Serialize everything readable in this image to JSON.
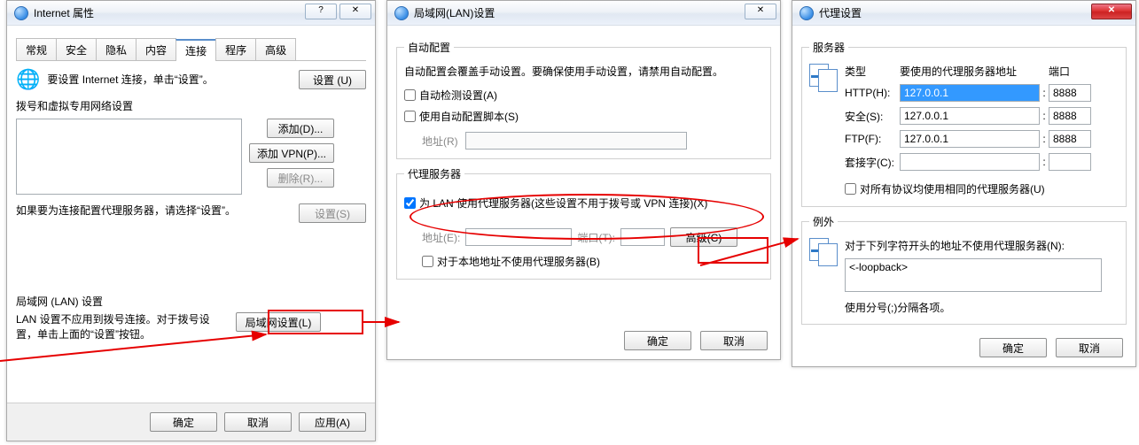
{
  "dlg1": {
    "title": "Internet 属性",
    "tabs": [
      "常规",
      "安全",
      "隐私",
      "内容",
      "连接",
      "程序",
      "高级"
    ],
    "active_tab_index": 4,
    "conn_hint": "要设置 Internet 连接，单击“设置”。",
    "btn_setup": "设置 (U)",
    "dialup_group": "拨号和虚拟专用网络设置",
    "btn_add": "添加(D)...",
    "btn_add_vpn": "添加 VPN(P)...",
    "btn_remove": "删除(R)...",
    "btn_settings": "设置(S)",
    "dialup_note": "如果要为连接配置代理服务器，请选择“设置”。",
    "lan_group": "局域网 (LAN) 设置",
    "lan_note": "LAN 设置不应用到拨号连接。对于拨号设置，单击上面的“设置”按钮。",
    "btn_lan": "局域网设置(L)",
    "ok": "确定",
    "cancel": "取消",
    "apply": "应用(A)"
  },
  "dlg2": {
    "title": "局域网(LAN)设置",
    "grp_auto": "自动配置",
    "auto_note": "自动配置会覆盖手动设置。要确保使用手动设置，请禁用自动配置。",
    "chk_auto_detect": "自动检测设置(A)",
    "chk_auto_script": "使用自动配置脚本(S)",
    "addr_r_label": "地址(R)",
    "addr_r_value": "",
    "grp_proxy": "代理服务器",
    "chk_use_proxy": "为 LAN 使用代理服务器(这些设置不用于拨号或 VPN 连接)(X)",
    "addr_e_label": "地址(E):",
    "addr_e_value": "",
    "port_t_label": "端口(T):",
    "port_t_value": "",
    "btn_adv": "高级(C)",
    "chk_bypass_local": "对于本地地址不使用代理服务器(B)",
    "ok": "确定",
    "cancel": "取消"
  },
  "dlg3": {
    "title": "代理设置",
    "grp_servers": "服务器",
    "hdr_type": "类型",
    "hdr_addr": "要使用的代理服务器地址",
    "hdr_port": "端口",
    "rows": {
      "http": {
        "label": "HTTP(H):",
        "addr": "127.0.0.1",
        "port": "8888"
      },
      "sec": {
        "label": "安全(S):",
        "addr": "127.0.0.1",
        "port": "8888"
      },
      "ftp": {
        "label": "FTP(F):",
        "addr": "127.0.0.1",
        "port": "8888"
      },
      "socks": {
        "label": "套接字(C):",
        "addr": "",
        "port": ""
      }
    },
    "chk_same_all": "对所有协议均使用相同的代理服务器(U)",
    "grp_except": "例外",
    "except_label": "对于下列字符开头的地址不使用代理服务器(N):",
    "except_value": "<-loopback>",
    "except_hint": "使用分号(;)分隔各项。",
    "ok": "确定",
    "cancel": "取消"
  }
}
